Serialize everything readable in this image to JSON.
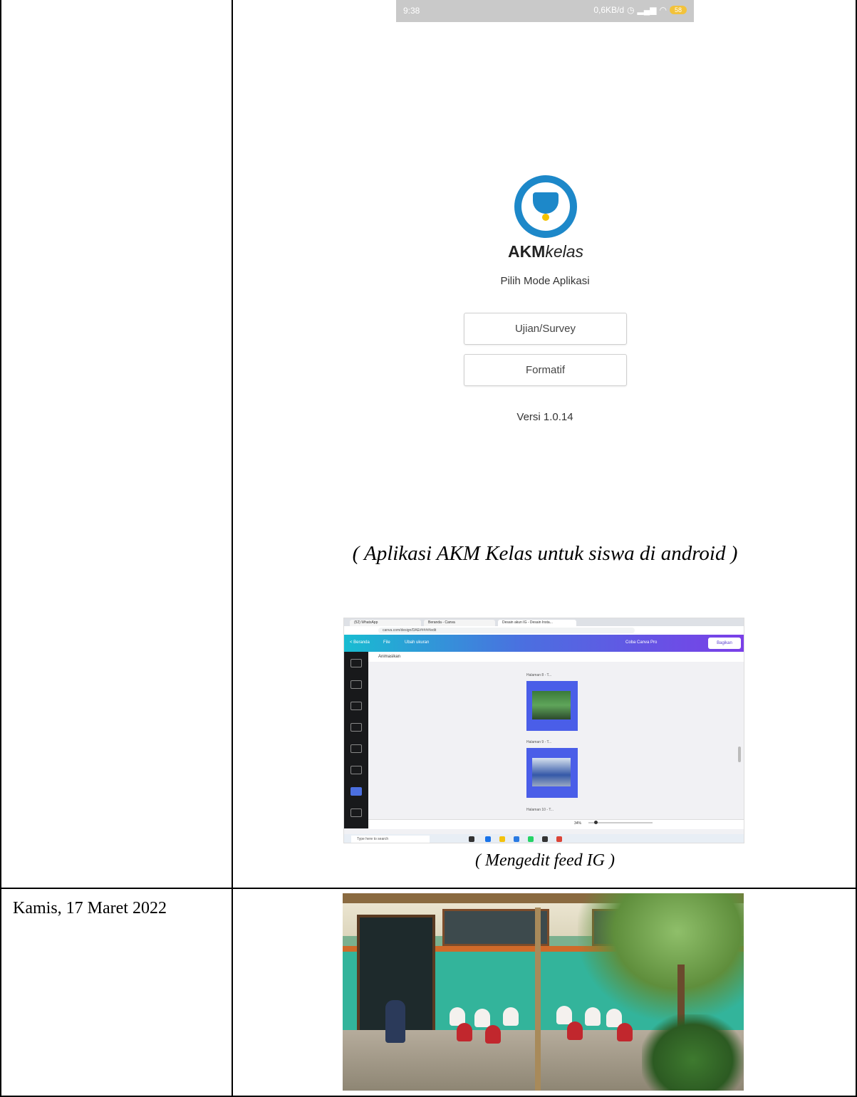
{
  "phone": {
    "status_time": "9:38",
    "status_speed": "0,6KB/d",
    "battery": "58",
    "app_name_bold": "AKM",
    "app_name_italic": "kelas",
    "subtitle": "Pilih Mode Aplikasi",
    "buttons": [
      "Ujian/Survey",
      "Formatif"
    ],
    "version": "Versi 1.0.14"
  },
  "captions": {
    "phone": "( Aplikasi AKM Kelas untuk siswa di android )",
    "desktop": "( Mengedit feed IG )"
  },
  "desktop": {
    "tabs": [
      "(52) WhatsApp",
      "Beranda - Canva",
      "Desain akun IG - Desain Insta..."
    ],
    "url": "canva.com/design/DAE#####/edit",
    "toolbar": [
      "< Beranda",
      "File",
      "Ubah ukuran"
    ],
    "share_label": "Bagikan",
    "try_pro": "Coba Canva Pro",
    "animate_label": "Animasikan",
    "pages": [
      "Halaman 8 - T...",
      "Halaman 9 - T...",
      "Halaman 10 - T..."
    ],
    "zoom": "34%",
    "search_placeholder": "Type here to search"
  },
  "entry": {
    "date": "Kamis, 17 Maret 2022"
  }
}
